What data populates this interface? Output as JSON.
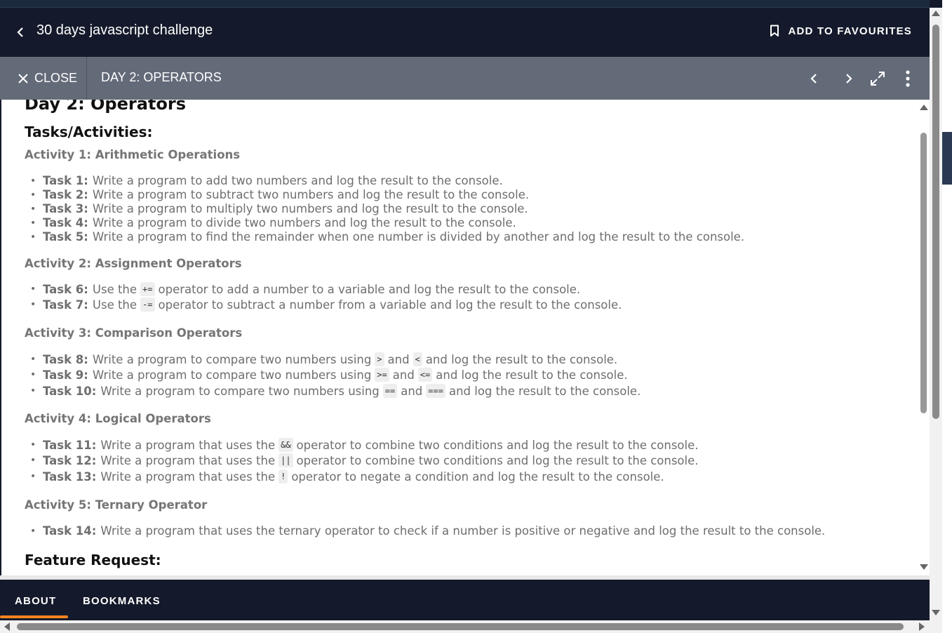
{
  "header": {
    "course_title": "30 days javascript challenge",
    "favourite_label": "ADD TO FAVOURITES"
  },
  "toolbar": {
    "close_label": "CLOSE",
    "lesson_title": "DAY 2: OPERATORS"
  },
  "content": {
    "day_heading": "Day 2: Operators",
    "tasks_heading": "Tasks/Activities:",
    "feature_heading": "Feature Request:",
    "activities": [
      {
        "title": "Activity 1: Arithmetic Operations",
        "tasks": [
          {
            "label": "Task 1:",
            "text": "Write a program to add two numbers and log the result to the console."
          },
          {
            "label": "Task 2:",
            "text": "Write a program to subtract two numbers and log the result to the console."
          },
          {
            "label": "Task 3:",
            "text": "Write a program to multiply two numbers and log the result to the console."
          },
          {
            "label": "Task 4:",
            "text": "Write a program to divide two numbers and log the result to the console."
          },
          {
            "label": "Task 5:",
            "text": "Write a program to find the remainder when one number is divided by another and log the result to the console."
          }
        ]
      },
      {
        "title": "Activity 2: Assignment Operators",
        "tasks": [
          {
            "label": "Task 6:",
            "pre": "Use the",
            "code1": "+=",
            "post": "operator to add a number to a variable and log the result to the console."
          },
          {
            "label": "Task 7:",
            "pre": "Use the",
            "code1": "-=",
            "post": "operator to subtract a number from a variable and log the result to the console."
          }
        ]
      },
      {
        "title": "Activity 3: Comparison Operators",
        "tasks": [
          {
            "label": "Task 8:",
            "pre": "Write a program to compare two numbers using",
            "code1": ">",
            "mid": "and",
            "code2": "<",
            "post": "and log the result to the console."
          },
          {
            "label": "Task 9:",
            "pre": "Write a program to compare two numbers using",
            "code1": ">=",
            "mid": "and",
            "code2": "<=",
            "post": "and log the result to the console."
          },
          {
            "label": "Task 10:",
            "pre": "Write a program to compare two numbers using",
            "code1": "==",
            "mid": "and",
            "code2": "===",
            "post": "and log the result to the console."
          }
        ]
      },
      {
        "title": "Activity 4: Logical Operators",
        "tasks": [
          {
            "label": "Task 11:",
            "pre": "Write a program that uses the",
            "code1": "&&",
            "post": "operator to combine two conditions and log the result to the console."
          },
          {
            "label": "Task 12:",
            "pre": "Write a program that uses the",
            "code1": "||",
            "post": "operator to combine two conditions and log the result to the console."
          },
          {
            "label": "Task 13:",
            "pre": "Write a program that uses the",
            "code1": "!",
            "post": "operator to negate a condition and log the result to the console."
          }
        ]
      },
      {
        "title": "Activity 5: Ternary Operator",
        "tasks": [
          {
            "label": "Task 14:",
            "text": "Write a program that uses the ternary operator to check if a number is positive or negative and log the result to the console."
          }
        ]
      }
    ]
  },
  "bottom_nav": {
    "tabs": [
      "ABOUT",
      "BOOKMARKS"
    ],
    "active_tab": "ABOUT"
  },
  "colors": {
    "header_bg": "#141a2b",
    "toolbar_bg": "#636a78",
    "accent": "#f5841f"
  },
  "icons": {
    "back": "chevron-left-icon",
    "favourite": "bookmark-icon",
    "close": "close-icon",
    "prev": "chevron-left-icon",
    "next": "chevron-right-icon",
    "fullscreen": "expand-icon",
    "more": "more-vertical-icon"
  }
}
